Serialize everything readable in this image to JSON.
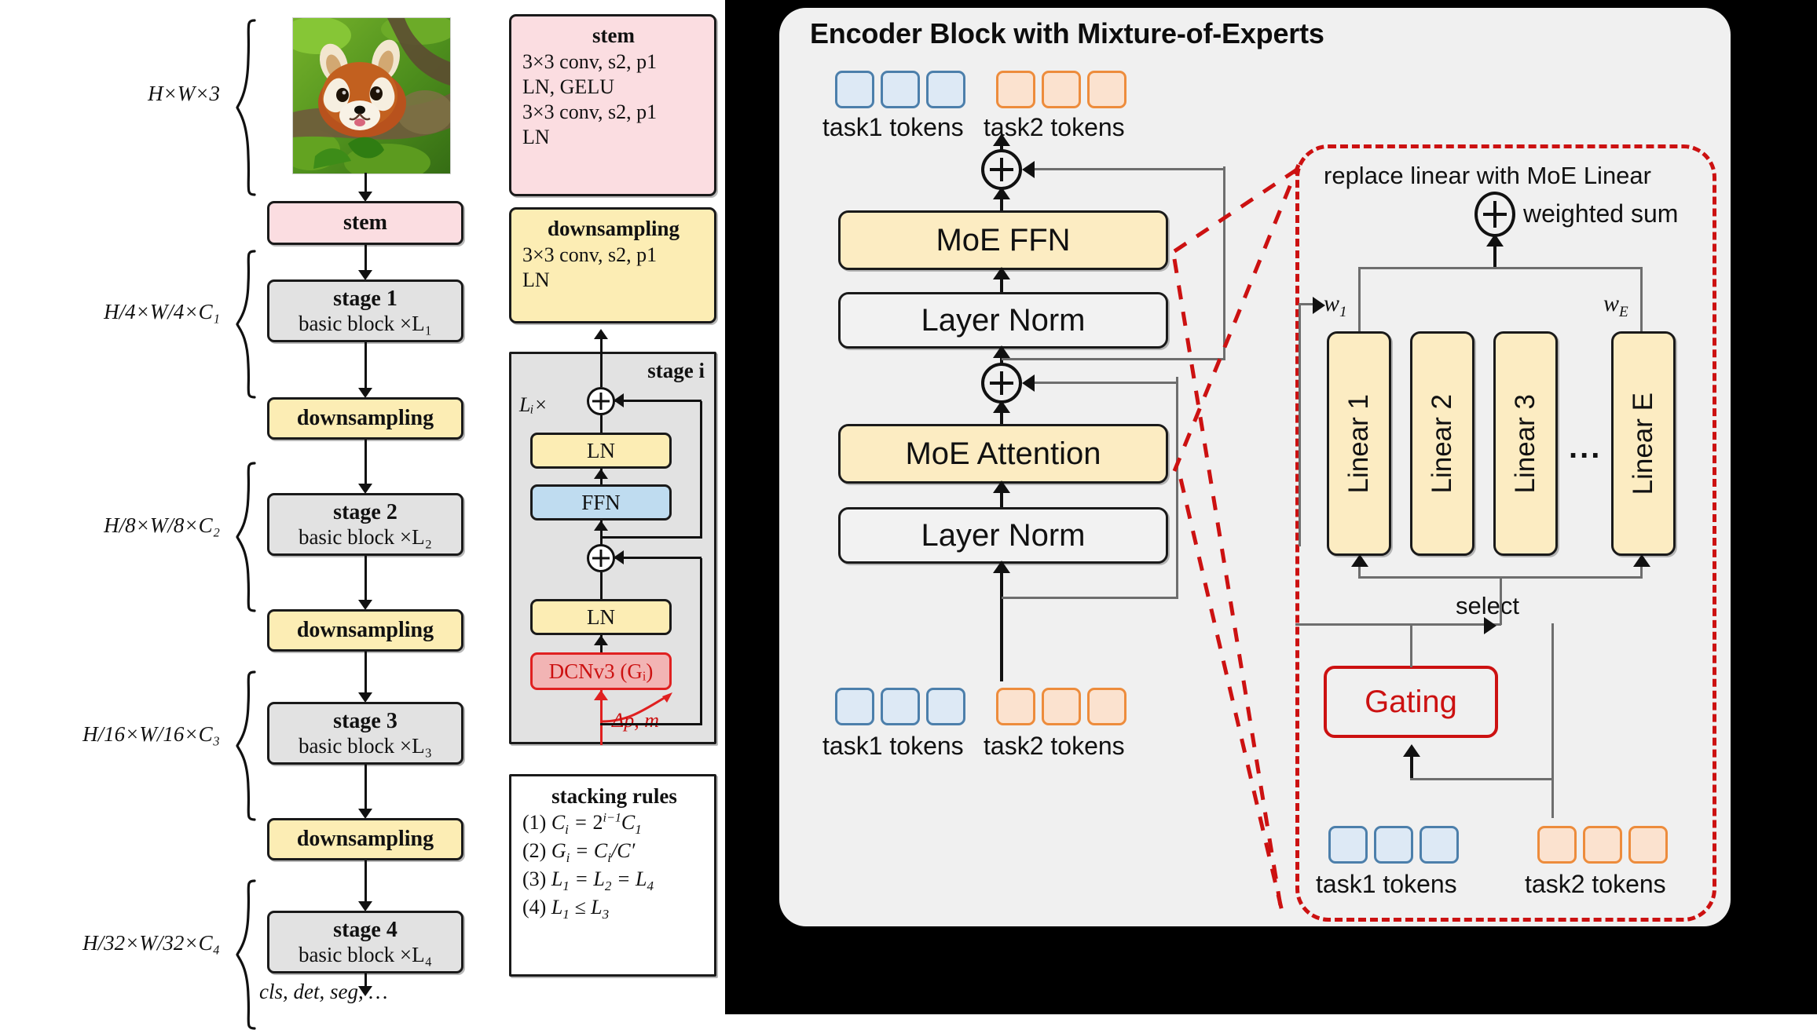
{
  "left": {
    "dim_labels": [
      {
        "id": "d0",
        "text": "H×W×3"
      },
      {
        "id": "d1",
        "text": "H/4×W/4×C₁"
      },
      {
        "id": "d2",
        "text": "H/8×W/8×C₂"
      },
      {
        "id": "d3",
        "text": "H/16×W/16×C₃"
      },
      {
        "id": "d4",
        "text": "H/32×W/32×C₄"
      }
    ],
    "stem_box": "stem",
    "stages": [
      {
        "title": "stage 1",
        "sub": "basic block ×L₁"
      },
      {
        "title": "stage 2",
        "sub": "basic block ×L₂"
      },
      {
        "title": "stage 3",
        "sub": "basic block ×L₃"
      },
      {
        "title": "stage 4",
        "sub": "basic block ×L₄"
      }
    ],
    "downsampling": "downsampling",
    "output_label": "cls, det, seg, …",
    "input_image_alt": "red panda photo"
  },
  "legend": {
    "stem": {
      "title": "stem",
      "lines": [
        "3×3 conv, s2, p1",
        "LN, GELU",
        "3×3 conv, s2, p1",
        "LN"
      ]
    },
    "downsampling": {
      "title": "downsampling",
      "lines": [
        "3×3 conv, s2, p1",
        "LN"
      ]
    },
    "stage_i": {
      "title": "stage i",
      "repeat": "Lᵢ×",
      "ln_top": "LN",
      "ffn": "FFN",
      "ln_bottom": "LN",
      "dcn": "DCNv3 (Gᵢ)",
      "offset": "Δp, m"
    },
    "stacking_rules": {
      "title": "stacking rules",
      "rules": [
        "(1) Cᵢ = 2^(i−1)C₁",
        "(2) Gᵢ = Cᵢ/C′",
        "(3) L₁ = L₂ = L₄",
        "(4) L₁ ≤ L₃"
      ]
    }
  },
  "right": {
    "title": "Encoder Block with Mixture-of-Experts",
    "token_group_task1": "task1 tokens",
    "token_group_task2": "task2 tokens",
    "blocks": {
      "moe_ffn": "MoE FFN",
      "layer_norm_top": "Layer Norm",
      "moe_attention": "MoE Attention",
      "layer_norm_bottom": "Layer Norm"
    },
    "moe_detail": {
      "caption": "replace linear with MoE Linear",
      "weighted_sum": "weighted sum",
      "experts": [
        "Linear 1",
        "Linear 2",
        "Linear 3",
        "Linear E"
      ],
      "ellipsis": "...",
      "weight_first": "w₁",
      "weight_last": "w_E",
      "gating": "Gating",
      "select": "select",
      "token_group_task1": "task1 tokens",
      "token_group_task2": "task2 tokens"
    }
  },
  "colors": {
    "pink": "#fbdde1",
    "yellow": "#fcedb4",
    "gray_block": "#e2e2e2",
    "blue_block": "#bfdcf0",
    "red_block": "#f2b4b4",
    "red_accent": "#cc1111",
    "cream": "#fcecc2",
    "token_blue_fill": "#dde9f5",
    "token_blue_border": "#4c7fab",
    "token_orange_fill": "#fbe2cf",
    "token_orange_border": "#ed8c3c",
    "panel_bg": "#f0f0f0",
    "panel_outer": "#000000"
  }
}
